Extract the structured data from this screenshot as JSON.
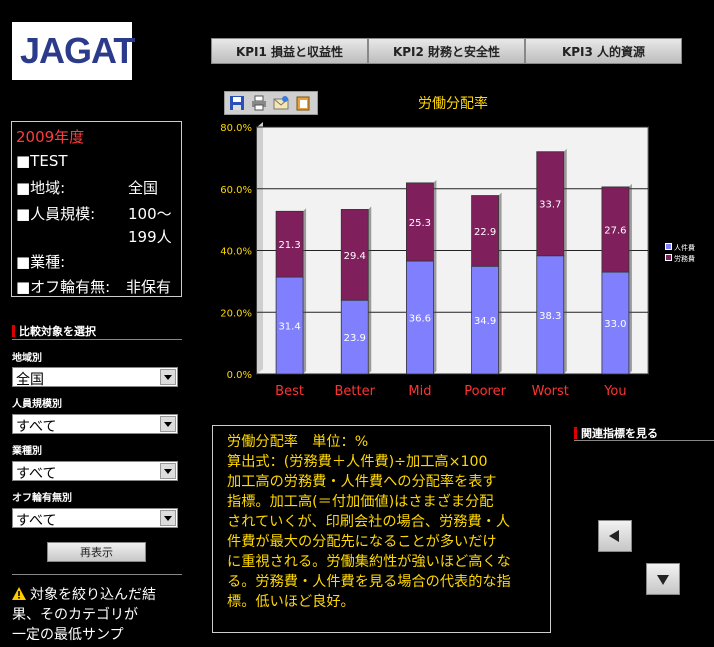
{
  "logo": {
    "text": "JAGAT"
  },
  "tabs": [
    {
      "label": "KPI1 損益と収益性"
    },
    {
      "label": "KPI2 財務と安全性"
    },
    {
      "label": "KPI3 人的資源"
    }
  ],
  "info": {
    "year": "2009年度",
    "rows": [
      {
        "label": "■TEST",
        "value": ""
      },
      {
        "label": "■地域:",
        "value": "全国"
      },
      {
        "label": "■人員規模:",
        "value": "100～"
      },
      {
        "label": "",
        "value": "199人"
      },
      {
        "label": "■業種:",
        "value": ""
      },
      {
        "label": "■オフ輪有無:",
        "value": "非保有"
      }
    ]
  },
  "filters": {
    "heading": "比較対象を選択",
    "items": [
      {
        "label": "地域別",
        "value": "全国"
      },
      {
        "label": "人員規模別",
        "value": "すべて"
      },
      {
        "label": "業種別",
        "value": "すべて"
      },
      {
        "label": "オフ輪有無別",
        "value": "すべて"
      }
    ],
    "button": "再表示"
  },
  "warning": {
    "icon": "warning-icon",
    "lines": [
      "対象を絞り込んだ結",
      "果、そのカテゴリが",
      "一定の最低サンプ"
    ]
  },
  "toolbar": {
    "icons": [
      "save-icon",
      "print-icon",
      "mail-icon",
      "copy-icon"
    ]
  },
  "chart_data": {
    "type": "bar",
    "stacked": true,
    "title": "労働分配率",
    "categories": [
      "Best",
      "Better",
      "Mid",
      "Poorer",
      "Worst",
      "You"
    ],
    "series": [
      {
        "name": "人件費",
        "values": [
          31.4,
          23.9,
          36.6,
          34.9,
          38.3,
          33.0
        ],
        "color": "#8080ff"
      },
      {
        "name": "労務費",
        "values": [
          21.3,
          29.4,
          25.3,
          22.9,
          33.7,
          27.6
        ],
        "color": "#7f1f5c"
      }
    ],
    "yticks": [
      "0.0%",
      "20.0%",
      "40.0%",
      "60.0%",
      "80.0%"
    ],
    "ylim": [
      0,
      80
    ],
    "grid": true,
    "legend": "right"
  },
  "description": {
    "lines": [
      "労働分配率　単位：%",
      "算出式：(労務費＋人件費)÷加工高×100",
      "加工高の労務費・人件費への分配率を表す",
      "指標。加工高(＝付加価値)はさまざま分配",
      "されていくが、印刷会社の場合、労務費・人",
      "件費が最大の分配先になることが多いだけ",
      "に重視される。労働集約性が強いほど高くな",
      "る。労務費・人件費を見る場合の代表的な指",
      "標。低いほど良好。"
    ]
  },
  "related": {
    "heading": "関連指標を見る",
    "left_icon": "arrow-left-icon",
    "down_icon": "arrow-down-icon"
  },
  "colors": {
    "axis_label": "#ffd800",
    "category_label": "#ff3333",
    "bar_label": "#ffffff"
  }
}
